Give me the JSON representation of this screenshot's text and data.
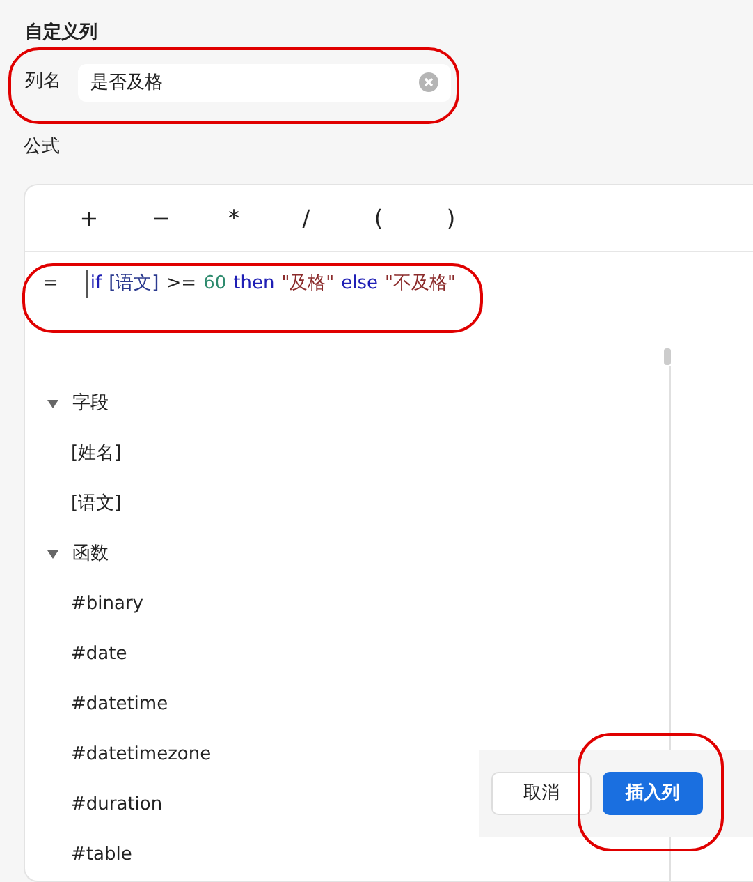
{
  "dialog": {
    "title": "自定义列"
  },
  "column_name": {
    "label": "列名",
    "value": "是否及格"
  },
  "formula": {
    "label": "公式",
    "operators": [
      "+",
      "−",
      "*",
      "/",
      "(",
      ")"
    ],
    "prefix": "=",
    "tokens": [
      {
        "kind": "keyword",
        "text": "if"
      },
      {
        "kind": "field",
        "text": "[语文]"
      },
      {
        "kind": "operator",
        "text": ">="
      },
      {
        "kind": "number",
        "text": "60"
      },
      {
        "kind": "keyword",
        "text": "then"
      },
      {
        "kind": "string",
        "text": "\"及格\""
      },
      {
        "kind": "keyword",
        "text": "else"
      },
      {
        "kind": "string",
        "text": "\"不及格\""
      }
    ]
  },
  "tree": [
    {
      "label": "字段",
      "expanded": true,
      "children": [
        {
          "label": "[姓名]"
        },
        {
          "label": "[语文]"
        }
      ]
    },
    {
      "label": "函数",
      "expanded": true,
      "children": [
        {
          "label": "#binary"
        },
        {
          "label": "#date"
        },
        {
          "label": "#datetime"
        },
        {
          "label": "#datetimezone"
        },
        {
          "label": "#duration"
        },
        {
          "label": "#table"
        }
      ]
    }
  ],
  "buttons": [
    {
      "kind": "secondary",
      "label": "取消"
    },
    {
      "kind": "primary",
      "label": "插入列"
    }
  ]
}
